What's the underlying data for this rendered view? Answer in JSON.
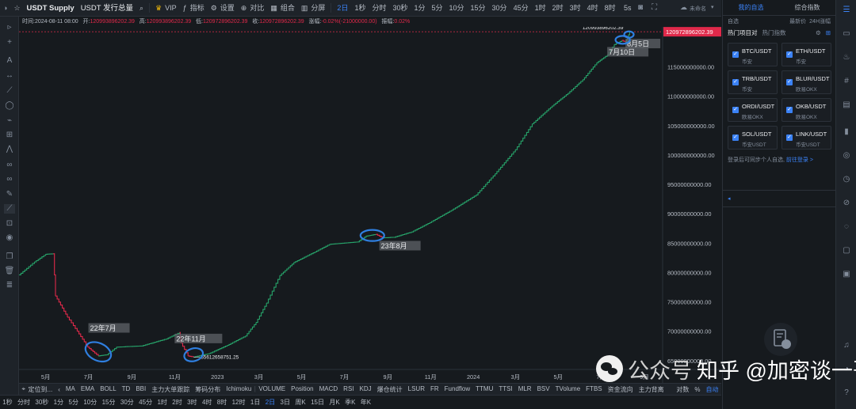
{
  "topbar": {
    "symbol": "USDT Supply",
    "subtitle": "USDT 发行总量",
    "vip": "VIP",
    "indicators": "指标",
    "settings": "设置",
    "compare": "对比",
    "combine": "组合",
    "split": "分屏",
    "intervals": [
      "2日",
      "1秒",
      "分时",
      "30秒",
      "1分",
      "5分",
      "10分",
      "15分",
      "30分",
      "45分",
      "1时",
      "2时",
      "3时",
      "4时",
      "8时"
    ],
    "active_interval": "2日",
    "screenshot_5s": "5s",
    "unnamed": "未命名"
  },
  "infobar": {
    "time_label": "时间:",
    "time_value": "2024-08-11 08:00",
    "open_label": "开:",
    "open_value": "120993896202.39",
    "high_label": "高:",
    "high_value": "120993896202.39",
    "low_label": "低:",
    "low_value": "120972896202.39",
    "close_label": "收:",
    "close_value": "120972896202.39",
    "change_label": "涨幅:",
    "change_value": "-0.02%(-21000000.00)",
    "amp_label": "振幅:",
    "amp_value": "0.02%"
  },
  "chart_data": {
    "type": "line",
    "title": "USDT Supply",
    "y_axis_ticks": [
      65000000000,
      70000000000,
      75000000000,
      80000000000,
      85000000000,
      90000000000,
      95000000000,
      100000000000,
      105000000000,
      110000000000,
      115000000000
    ],
    "y_tick_labels": [
      "65000000000.00",
      "70000000000.00",
      "75000000000.00",
      "80000000000.00",
      "85000000000.00",
      "90000000000.00",
      "95000000000.00",
      "100000000000.00",
      "105000000000.00",
      "110000000000.00",
      "115000000000.00"
    ],
    "ylim": [
      63500000000,
      121800000000
    ],
    "x_tick_labels": [
      "5月",
      "7月",
      "9月",
      "11月",
      "2023",
      "3月",
      "5月",
      "7月",
      "9月",
      "11月",
      "2024",
      "3月",
      "5月",
      "7月",
      "9月"
    ],
    "x_tick_dates": [
      "2022-05-01",
      "2022-07-01",
      "2022-09-01",
      "2022-11-01",
      "2023-01-01",
      "2023-03-01",
      "2023-05-01",
      "2023-07-01",
      "2023-09-01",
      "2023-11-01",
      "2024-01-01",
      "2024-03-01",
      "2024-05-01",
      "2024-07-01",
      "2024-09-01"
    ],
    "xlim": [
      "2022-03-24",
      "2024-09-27"
    ],
    "current_price": 120972896202.39,
    "current_price_label": "120972896202.39",
    "max_label": "120993896202.39",
    "min_label": "65612658751.25",
    "series": [
      {
        "date": "2022-03-24",
        "value": 79600000000
      },
      {
        "date": "2022-04-15",
        "value": 81800000000
      },
      {
        "date": "2022-05-01",
        "value": 83100000000
      },
      {
        "date": "2022-05-12",
        "value": 83200000000
      },
      {
        "date": "2022-05-15",
        "value": 76000000000
      },
      {
        "date": "2022-06-01",
        "value": 72400000000
      },
      {
        "date": "2022-06-15",
        "value": 70000000000
      },
      {
        "date": "2022-06-30",
        "value": 67300000000
      },
      {
        "date": "2022-07-15",
        "value": 65800000000
      },
      {
        "date": "2022-07-27",
        "value": 66000000000
      },
      {
        "date": "2022-08-10",
        "value": 67300000000
      },
      {
        "date": "2022-09-15",
        "value": 67500000000
      },
      {
        "date": "2022-10-20",
        "value": 68700000000
      },
      {
        "date": "2022-11-08",
        "value": 69800000000
      },
      {
        "date": "2022-11-10",
        "value": 68000000000
      },
      {
        "date": "2022-11-20",
        "value": 65800000000
      },
      {
        "date": "2022-11-28",
        "value": 65612658751.25
      },
      {
        "date": "2022-12-20",
        "value": 66200000000
      },
      {
        "date": "2023-01-15",
        "value": 67600000000
      },
      {
        "date": "2023-02-10",
        "value": 69200000000
      },
      {
        "date": "2023-02-25",
        "value": 71500000000
      },
      {
        "date": "2023-03-12",
        "value": 74800000000
      },
      {
        "date": "2023-03-31",
        "value": 79500000000
      },
      {
        "date": "2023-04-20",
        "value": 81700000000
      },
      {
        "date": "2023-05-20",
        "value": 83500000000
      },
      {
        "date": "2023-06-10",
        "value": 84800000000
      },
      {
        "date": "2023-07-20",
        "value": 85200000000
      },
      {
        "date": "2023-08-01",
        "value": 86200000000
      },
      {
        "date": "2023-08-15",
        "value": 86500000000
      },
      {
        "date": "2023-08-25",
        "value": 85900000000
      },
      {
        "date": "2023-09-10",
        "value": 86000000000
      },
      {
        "date": "2023-10-05",
        "value": 86900000000
      },
      {
        "date": "2023-10-31",
        "value": 88500000000
      },
      {
        "date": "2023-12-01",
        "value": 90600000000
      },
      {
        "date": "2024-01-05",
        "value": 93200000000
      },
      {
        "date": "2024-02-01",
        "value": 96800000000
      },
      {
        "date": "2024-03-01",
        "value": 100900000000
      },
      {
        "date": "2024-03-25",
        "value": 105300000000
      },
      {
        "date": "2024-04-20",
        "value": 108100000000
      },
      {
        "date": "2024-05-15",
        "value": 110500000000
      },
      {
        "date": "2024-06-05",
        "value": 112800000000
      },
      {
        "date": "2024-06-25",
        "value": 115700000000
      },
      {
        "date": "2024-07-10",
        "value": 117000000000
      },
      {
        "date": "2024-07-20",
        "value": 118800000000
      },
      {
        "date": "2024-07-31",
        "value": 119500000000
      },
      {
        "date": "2024-08-05",
        "value": 119200000000
      },
      {
        "date": "2024-08-08",
        "value": 119900000000
      },
      {
        "date": "2024-08-11",
        "value": 120993896202.39
      },
      {
        "date": "2024-08-12",
        "value": 120972896202.39
      }
    ],
    "up_color": "#26a269",
    "down_color": "#e0294a",
    "annotations": [
      {
        "label": "22年7月",
        "date": "2022-07-01",
        "value": 70300000000
      },
      {
        "label": "22年11月",
        "date": "2022-11-01",
        "value": 68500000000
      },
      {
        "label": "23年8月",
        "date": "2023-08-20",
        "value": 84300000000
      },
      {
        "label": "7月10日",
        "date": "2024-07-10",
        "value": 117300000000
      },
      {
        "label": "8月5日",
        "date": "2024-08-05",
        "value": 118700000000
      }
    ],
    "circles": [
      {
        "date": "2022-07-15",
        "value": 66500000000
      },
      {
        "date": "2022-11-28",
        "value": 66000000000
      },
      {
        "date": "2023-08-10",
        "value": 86300000000
      },
      {
        "date": "2024-08-01",
        "value": 119600000000
      },
      {
        "date": "2024-08-10",
        "value": 120500000000
      }
    ]
  },
  "indicators_bar": {
    "locate": "定位到...",
    "items": [
      "MA",
      "EMA",
      "BOLL",
      "TD",
      "BBI",
      "主力大单跟踪",
      "筹码分布",
      "Ichimoku",
      "VOLUME",
      "Position",
      "MACD",
      "RSI",
      "KDJ",
      "爆仓统计",
      "LSUR",
      "FR",
      "Fundflow",
      "TTMU",
      "TTSI",
      "MLR",
      "BSV",
      "TVolume",
      "FTBS",
      "资金流向",
      "主力背离"
    ],
    "log": "对数",
    "percent": "%",
    "auto": "自动"
  },
  "timeframe_bar": {
    "items": [
      "1秒",
      "分时",
      "30秒",
      "1分",
      "5分",
      "10分",
      "15分",
      "30分",
      "45分",
      "1时",
      "2时",
      "3时",
      "4时",
      "8时",
      "12时",
      "1日",
      "2日",
      "3日",
      "周K",
      "15日",
      "月K",
      "季K",
      "年K"
    ],
    "active": "2日"
  },
  "right_panel": {
    "tab_mine": "我的自选",
    "tab_composite": "综合指数",
    "sub_watch": "自选",
    "sub_latest": "最新价",
    "sub_24h": "24H涨幅",
    "hot_projects": "热门项目对",
    "hot_index": "热门指数",
    "pairs": [
      {
        "pair": "BTC/USDT",
        "exchange": "币安"
      },
      {
        "pair": "ETH/USDT",
        "exchange": "币安"
      },
      {
        "pair": "TRB/USDT",
        "exchange": "币安"
      },
      {
        "pair": "BLUR/USDT",
        "exchange": "欧易OKX"
      },
      {
        "pair": "ORDI/USDT",
        "exchange": "欧易OKX"
      },
      {
        "pair": "OKB/USDT",
        "exchange": "欧易OKX"
      },
      {
        "pair": "SOL/USDT",
        "exchange": "币安USDT"
      },
      {
        "pair": "LINK/USDT",
        "exchange": "币安USDT"
      }
    ],
    "login_hint": "登录后可同步个人自选,",
    "login_link": "前往登录 >"
  },
  "watermark": {
    "text_a": "公众号",
    "text_b": "知乎 @加密谈一哥"
  }
}
